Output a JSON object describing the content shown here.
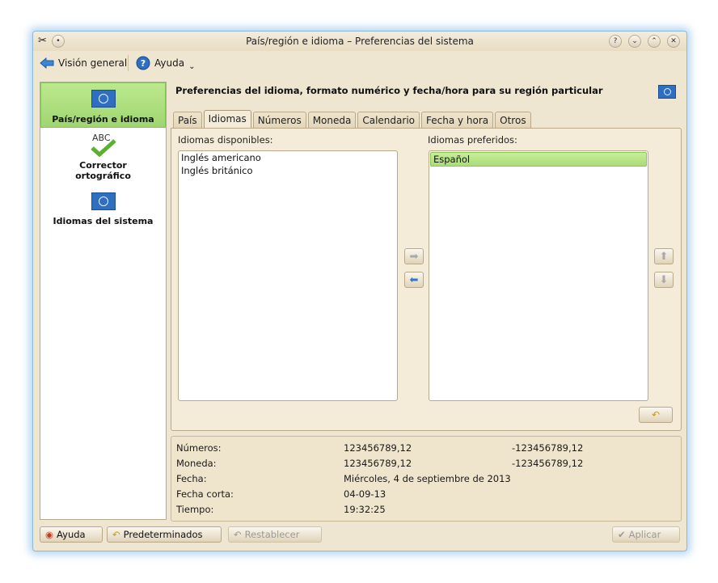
{
  "window": {
    "title": "País/región e idioma – Preferencias del sistema"
  },
  "toolbar": {
    "overview_label": "Visión general",
    "help_label": "Ayuda"
  },
  "sidebar": {
    "items": [
      {
        "label": "País/región e idioma"
      },
      {
        "label": "Corrector ortográfico",
        "icon_text": "ABC"
      },
      {
        "label": "Idiomas del sistema"
      }
    ]
  },
  "header": {
    "text": "Preferencias del idioma, formato numérico y fecha/hora para su región particular"
  },
  "tabs": [
    "País",
    "Idiomas",
    "Números",
    "Moneda",
    "Calendario",
    "Fecha y hora",
    "Otros"
  ],
  "languages": {
    "available_label": "Idiomas disponibles:",
    "available": [
      "Inglés americano",
      "Inglés británico"
    ],
    "preferred_label": "Idiomas preferidos:",
    "preferred": [
      "Español"
    ]
  },
  "samples": {
    "rows": [
      {
        "label": "Números:",
        "value1": "123456789,12",
        "value2": "-123456789,12"
      },
      {
        "label": "Moneda:",
        "value1": "123456789,12",
        "value2": "-123456789,12"
      },
      {
        "label": "Fecha:",
        "value1": "Miércoles, 4 de septiembre de 2013",
        "value2": ""
      },
      {
        "label": "Fecha corta:",
        "value1": "04-09-13",
        "value2": ""
      },
      {
        "label": "Tiempo:",
        "value1": "19:32:25",
        "value2": ""
      }
    ]
  },
  "buttons": {
    "help": "Ayuda",
    "defaults": "Predeterminados",
    "reset": "Restablecer",
    "apply": "Aplicar"
  },
  "colors": {
    "selection_green": "#a9dc76",
    "window_bg": "#efe6d2",
    "accent_blue": "#2e79cc"
  }
}
